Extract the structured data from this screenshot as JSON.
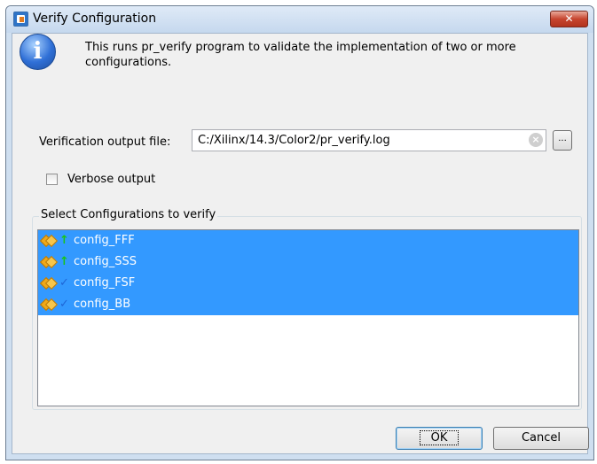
{
  "window": {
    "title": "Verify Configuration",
    "close_label": "✕"
  },
  "info": {
    "icon": "info-icon",
    "text": "This runs pr_verify program to validate the implementation of two or more configurations."
  },
  "output_file": {
    "label": "Verification output file:",
    "value": "C:/Xilinx/14.3/Color2/pr_verify.log",
    "browse_label": "..."
  },
  "verbose": {
    "label": "Verbose output",
    "checked": false
  },
  "configurations": {
    "group_label": "Select Configurations to verify",
    "items": [
      {
        "label": "config_FFF",
        "status_icon": "up-arrow-icon",
        "selected": true
      },
      {
        "label": "config_SSS",
        "status_icon": "up-arrow-icon",
        "selected": true
      },
      {
        "label": "config_FSF",
        "status_icon": "checkmark-icon",
        "selected": true
      },
      {
        "label": "config_BB",
        "status_icon": "checkmark-icon",
        "selected": true
      }
    ]
  },
  "buttons": {
    "ok": "OK",
    "cancel": "Cancel"
  },
  "colors": {
    "selection": "#3399ff",
    "titlebar": "#c5d8ee",
    "close": "#c7452f"
  }
}
